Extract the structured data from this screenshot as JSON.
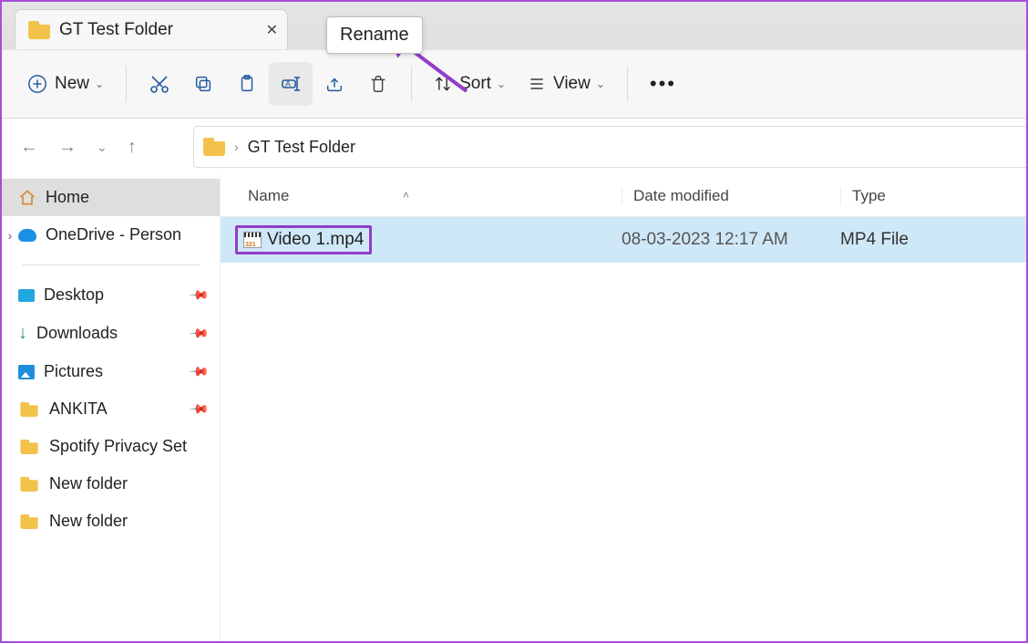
{
  "tab": {
    "title": "GT Test Folder"
  },
  "tooltip": "Rename",
  "toolbar": {
    "new_label": "New",
    "sort_label": "Sort",
    "view_label": "View"
  },
  "breadcrumb": {
    "root": "GT Test Folder"
  },
  "sidebar": {
    "home": "Home",
    "onedrive": "OneDrive - Person",
    "items": [
      {
        "label": "Desktop",
        "pinned": true,
        "type": "desktop"
      },
      {
        "label": "Downloads",
        "pinned": true,
        "type": "downloads"
      },
      {
        "label": "Pictures",
        "pinned": true,
        "type": "pictures"
      },
      {
        "label": "ANKITA",
        "pinned": true,
        "type": "folder"
      },
      {
        "label": "Spotify Privacy Set",
        "pinned": false,
        "type": "folder"
      },
      {
        "label": "New folder",
        "pinned": false,
        "type": "folder"
      },
      {
        "label": "New folder",
        "pinned": false,
        "type": "folder"
      }
    ]
  },
  "columns": {
    "name": "Name",
    "date": "Date modified",
    "type": "Type"
  },
  "files": [
    {
      "name": "Video 1.mp4",
      "date": "08-03-2023 12:17 AM",
      "type": "MP4 File"
    }
  ]
}
